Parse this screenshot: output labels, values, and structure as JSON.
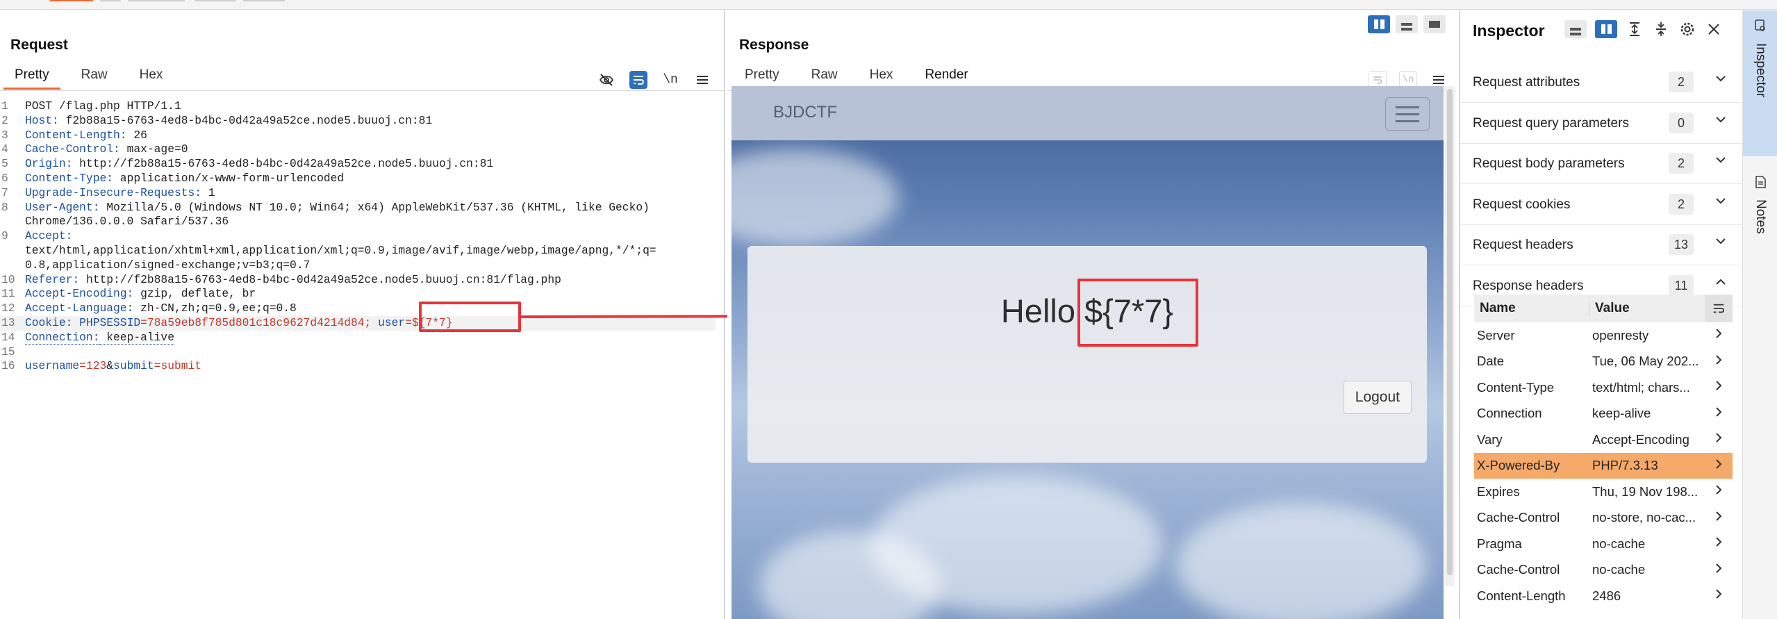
{
  "request": {
    "title": "Request",
    "tabs": [
      "Pretty",
      "Raw",
      "Hex"
    ],
    "active_tab": "Pretty",
    "lines": [
      {
        "n": "1",
        "key": "",
        "val": "POST /flag.php HTTP/1.1"
      },
      {
        "n": "2",
        "key": "Host:",
        "val": " f2b88a15-6763-4ed8-b4bc-0d42a49a52ce.node5.buuoj.cn:81"
      },
      {
        "n": "3",
        "key": "Content-Length:",
        "val": " 26"
      },
      {
        "n": "4",
        "key": "Cache-Control:",
        "val": " max-age=0"
      },
      {
        "n": "5",
        "key": "Origin:",
        "val": " http://f2b88a15-6763-4ed8-b4bc-0d42a49a52ce.node5.buuoj.cn:81"
      },
      {
        "n": "6",
        "key": "Content-Type:",
        "val": " application/x-www-form-urlencoded"
      },
      {
        "n": "7",
        "key": "Upgrade-Insecure-Requests:",
        "val": " 1"
      },
      {
        "n": "8",
        "key": "User-Agent:",
        "val": " Mozilla/5.0 (Windows NT 10.0; Win64; x64) AppleWebKit/537.36 (KHTML, like Gecko)"
      },
      {
        "n": "",
        "key": "",
        "val": "Chrome/136.0.0.0 Safari/537.36"
      },
      {
        "n": "9",
        "key": "Accept:",
        "val": ""
      },
      {
        "n": "",
        "key": "",
        "val": "text/html,application/xhtml+xml,application/xml;q=0.9,image/avif,image/webp,image/apng,*/*;q="
      },
      {
        "n": "",
        "key": "",
        "val": "0.8,application/signed-exchange;v=b3;q=0.7"
      },
      {
        "n": "10",
        "key": "Referer:",
        "val": " http://f2b88a15-6763-4ed8-b4bc-0d42a49a52ce.node5.buuoj.cn:81/flag.php"
      },
      {
        "n": "11",
        "key": "Accept-Encoding:",
        "val": " gzip, deflate, br"
      },
      {
        "n": "12",
        "key": "Accept-Language:",
        "val": " zh-CN,zh;q=0.9,ee;q=0.8"
      }
    ],
    "cookie_line": {
      "n": "13",
      "key": "Cookie:",
      "c1k": " PHPSESSID",
      "c1v": "=78a59eb8f785d801c18c9627d4214d84; ",
      "c2k": "user",
      "c2v": "=${7*7}"
    },
    "conn_line": {
      "n": "14",
      "key": "Connection:",
      "val": " keep-alive"
    },
    "blank_line": {
      "n": "15"
    },
    "body_line": {
      "n": "16",
      "k1": "username",
      "v1": "=123",
      "amp": "&",
      "k2": "submit",
      "v2": "=submit"
    }
  },
  "response": {
    "title": "Response",
    "tabs": [
      "Pretty",
      "Raw",
      "Hex",
      "Render"
    ],
    "active_tab": "Render",
    "render": {
      "brand": "BJDCTF",
      "hello_prefix": "Hello ",
      "hello_payload": "${7*7}",
      "logout_label": "Logout"
    }
  },
  "inspector": {
    "title": "Inspector",
    "sections": [
      {
        "label": "Request attributes",
        "count": "2",
        "expanded": false
      },
      {
        "label": "Request query parameters",
        "count": "0",
        "expanded": false
      },
      {
        "label": "Request body parameters",
        "count": "2",
        "expanded": false
      },
      {
        "label": "Request cookies",
        "count": "2",
        "expanded": false
      },
      {
        "label": "Request headers",
        "count": "13",
        "expanded": false
      },
      {
        "label": "Response headers",
        "count": "11",
        "expanded": true
      }
    ],
    "table_header": {
      "name": "Name",
      "value": "Value"
    },
    "response_headers": [
      {
        "name": "Server",
        "value": "openresty"
      },
      {
        "name": "Date",
        "value": "Tue, 06 May 202..."
      },
      {
        "name": "Content-Type",
        "value": "text/html; chars..."
      },
      {
        "name": "Connection",
        "value": "keep-alive"
      },
      {
        "name": "Vary",
        "value": "Accept-Encoding"
      },
      {
        "name": "X-Powered-By",
        "value": "PHP/7.3.13",
        "selected": true
      },
      {
        "name": "Expires",
        "value": "Thu, 19 Nov 198..."
      },
      {
        "name": "Cache-Control",
        "value": "no-store, no-cac..."
      },
      {
        "name": "Pragma",
        "value": "no-cache"
      },
      {
        "name": "Cache-Control",
        "value": "no-cache"
      },
      {
        "name": "Content-Length",
        "value": "2486"
      }
    ]
  },
  "rail": {
    "tabs": [
      "Inspector",
      "Notes"
    ]
  },
  "colors": {
    "accent_orange": "#e96a32",
    "selected_row": "#f5aa6a",
    "header_key": "#1a4fa0",
    "cookie_value": "#c0392b",
    "annotation_red": "#e8343a",
    "toggle_blue": "#2e6fba"
  },
  "icons": [
    "hide-icon",
    "wrap-icon",
    "newline-icon",
    "menu-icon",
    "layout-icon",
    "expand-all-icon",
    "collapse-all-icon",
    "settings-icon",
    "close-icon",
    "notes-icon"
  ]
}
